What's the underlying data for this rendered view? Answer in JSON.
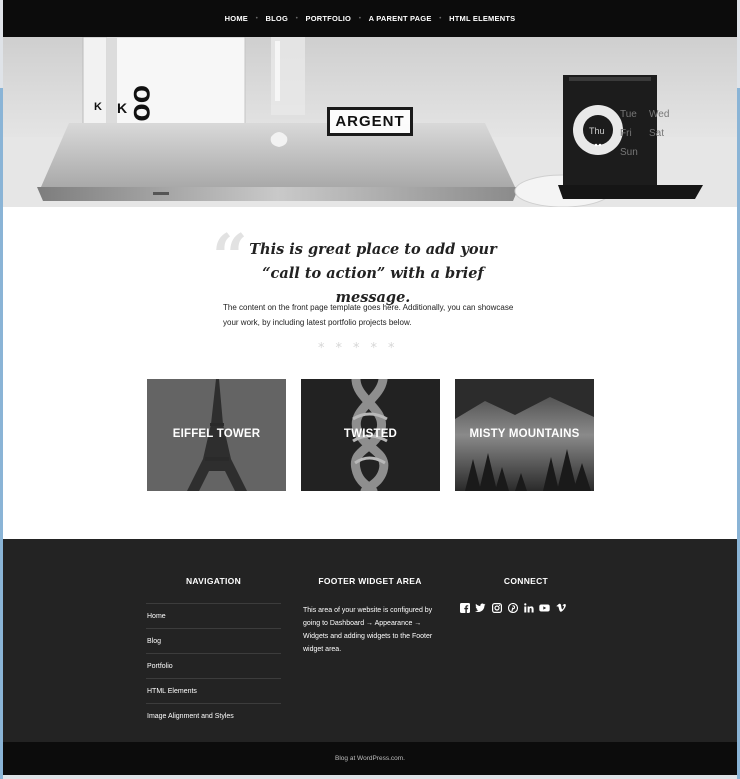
{
  "nav": {
    "items": [
      {
        "label": "HOME"
      },
      {
        "label": "BLOG"
      },
      {
        "label": "PORTFOLIO"
      },
      {
        "label": "A PARENT PAGE"
      },
      {
        "label": "HTML ELEMENTS"
      }
    ],
    "separator": "•"
  },
  "hero": {
    "site_title": "ARGENT",
    "book_spine_text": "ool",
    "calendar_days": [
      "Tue",
      "Wed",
      "Thu",
      "Fri",
      "Sat",
      "Sun"
    ]
  },
  "cta": {
    "heading": "This is great place to add your “call to action” with a brief message.",
    "body": "The content on the front page template goes here. Additionally, you can showcase your work, by including latest portfolio projects below.",
    "stars": [
      "*",
      "*",
      "*",
      "*",
      "*"
    ]
  },
  "portfolio": {
    "tiles": [
      {
        "title": "EIFFEL TOWER"
      },
      {
        "title": "TWISTED"
      },
      {
        "title": "MISTY MOUNTAINS"
      }
    ]
  },
  "footer": {
    "navigation_title": "NAVIGATION",
    "navigation_links": [
      {
        "label": "Home"
      },
      {
        "label": "Blog"
      },
      {
        "label": "Portfolio"
      },
      {
        "label": "HTML Elements"
      },
      {
        "label": "Image Alignment and Styles"
      }
    ],
    "widget_title": "FOOTER WIDGET AREA",
    "widget_text": "This area of your website is configured by going to Dashboard → Appearance → Widgets and adding widgets to the Footer widget area.",
    "connect_title": "CONNECT",
    "social_icons": [
      "facebook-icon",
      "twitter-icon",
      "instagram-icon",
      "pinterest-icon",
      "linkedin-icon",
      "youtube-icon",
      "vimeo-icon"
    ],
    "credit": "Blog at WordPress.com."
  }
}
